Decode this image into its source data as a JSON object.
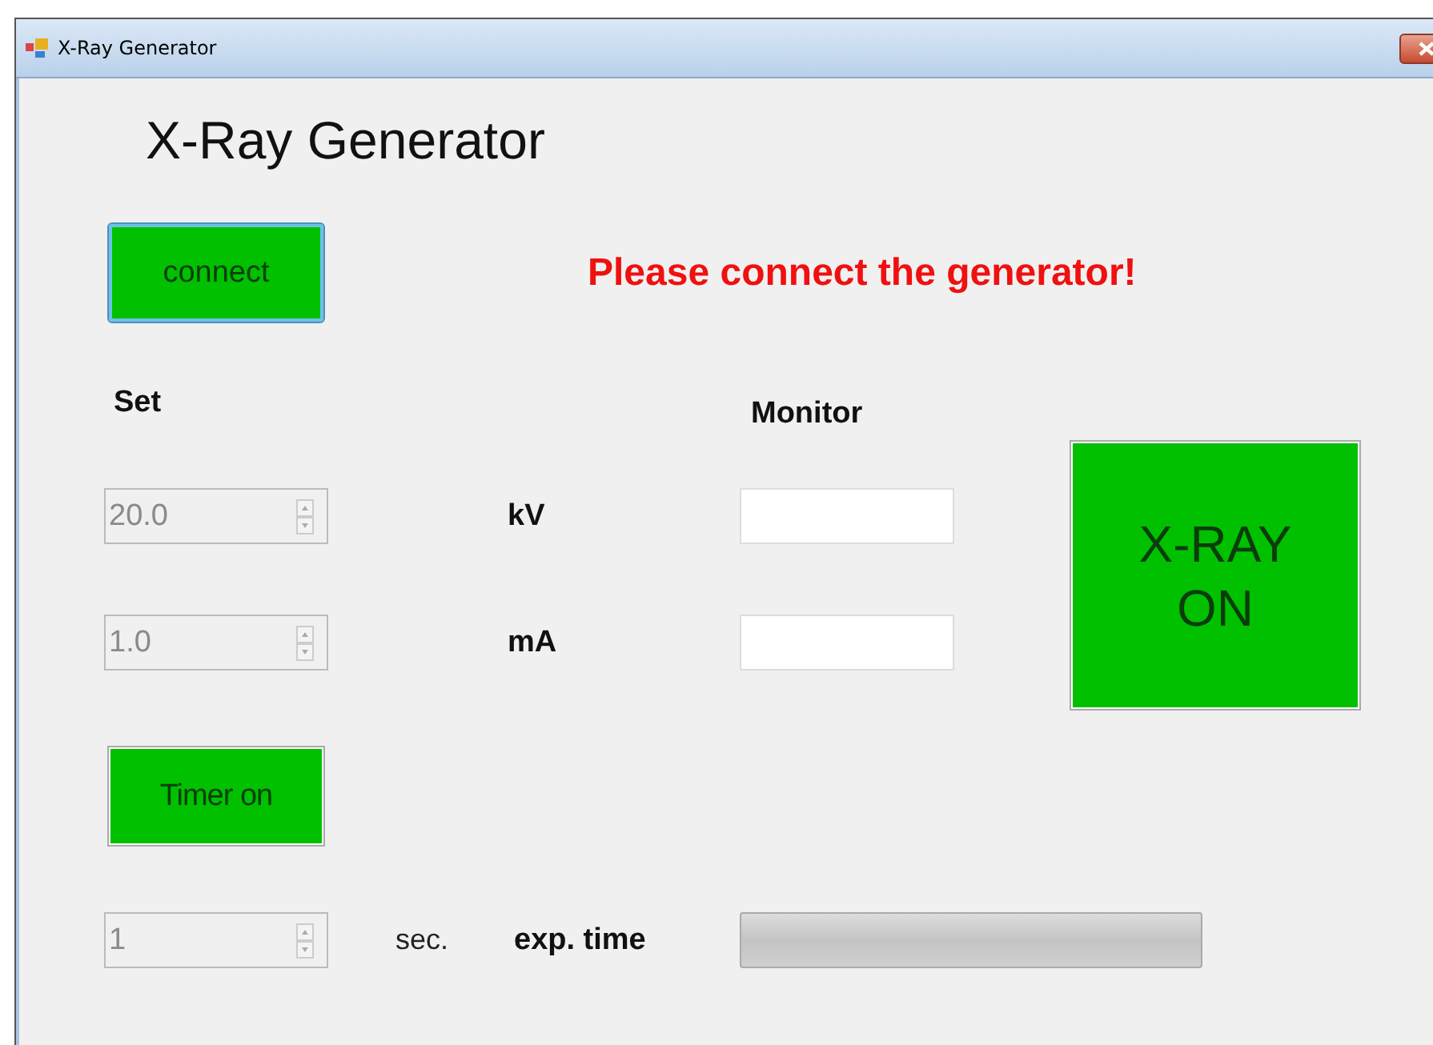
{
  "window": {
    "title": "X-Ray Generator"
  },
  "heading": "X-Ray Generator",
  "connect_button": {
    "label": "connect",
    "focused": true
  },
  "message": "Please connect the generator!",
  "set_label": "Set",
  "monitor_label": "Monitor",
  "settings": [
    {
      "value": "20.0",
      "unit": "kV",
      "disabled": true
    },
    {
      "value": "1.0",
      "unit": "mA",
      "disabled": true
    }
  ],
  "xray_button": {
    "label": "X-RAY ON"
  },
  "timer_button": {
    "label": "Timer on"
  },
  "exposure": {
    "value": "1",
    "disabled": true,
    "unit": "sec.",
    "label": "exp. time",
    "level": 0
  }
}
